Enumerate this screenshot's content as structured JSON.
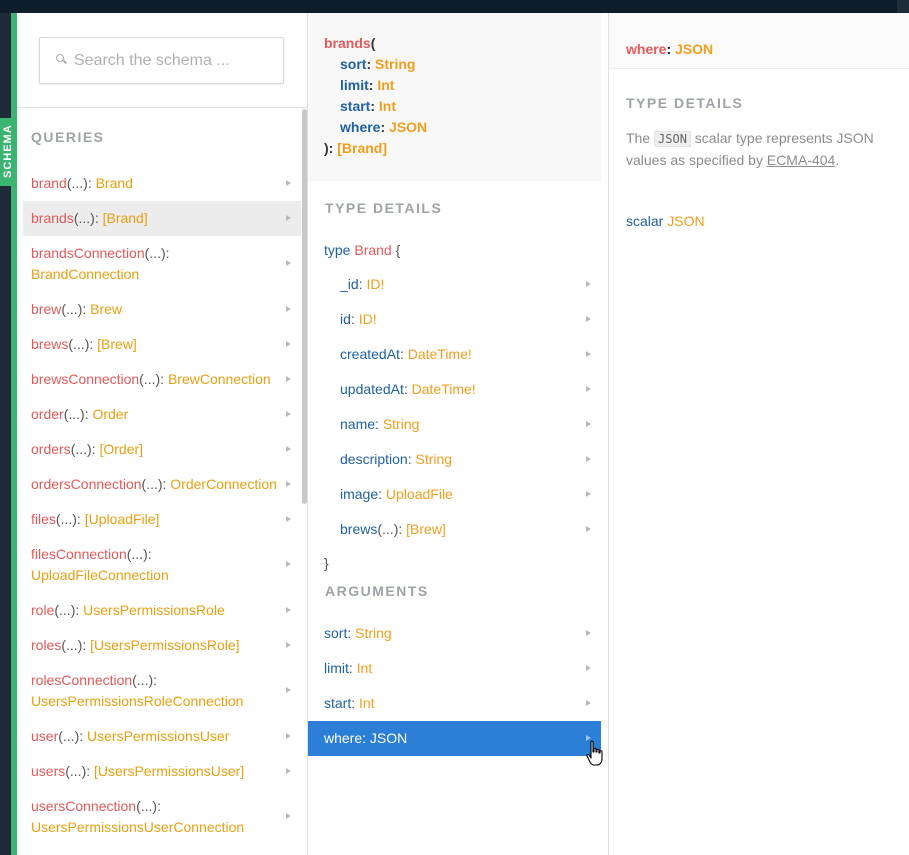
{
  "sidebar_tab": "SCHEMA",
  "search": {
    "placeholder": "Search the schema ..."
  },
  "queries": {
    "title": "QUERIES",
    "items": [
      {
        "name": "brand",
        "args": "(...)",
        "sep": ": ",
        "type": "Brand"
      },
      {
        "name": "brands",
        "args": "(...)",
        "sep": ": ",
        "type": "[Brand]"
      },
      {
        "name": "brandsConnection",
        "args": "(...)",
        "sep": ": ",
        "type": "BrandConnection"
      },
      {
        "name": "brew",
        "args": "(...)",
        "sep": ": ",
        "type": "Brew"
      },
      {
        "name": "brews",
        "args": "(...)",
        "sep": ": ",
        "type": "[Brew]"
      },
      {
        "name": "brewsConnection",
        "args": "(...)",
        "sep": ": ",
        "type": "BrewConnection"
      },
      {
        "name": "order",
        "args": "(...)",
        "sep": ": ",
        "type": "Order"
      },
      {
        "name": "orders",
        "args": "(...)",
        "sep": ": ",
        "type": "[Order]"
      },
      {
        "name": "ordersConnection",
        "args": "(...)",
        "sep": ": ",
        "type": "OrderConnection"
      },
      {
        "name": "files",
        "args": "(...)",
        "sep": ": ",
        "type": "[UploadFile]"
      },
      {
        "name": "filesConnection",
        "args": "(...)",
        "sep": ": ",
        "type": "UploadFileConnection"
      },
      {
        "name": "role",
        "args": "(...)",
        "sep": ": ",
        "type": "UsersPermissionsRole"
      },
      {
        "name": "roles",
        "args": "(...)",
        "sep": ": ",
        "type": "[UsersPermissionsRole]"
      },
      {
        "name": "rolesConnection",
        "args": "(...)",
        "sep": ": ",
        "type": "UsersPermissionsRoleConnection"
      },
      {
        "name": "user",
        "args": "(...)",
        "sep": ": ",
        "type": "UsersPermissionsUser"
      },
      {
        "name": "users",
        "args": "(...)",
        "sep": ": ",
        "type": "[UsersPermissionsUser]"
      },
      {
        "name": "usersConnection",
        "args": "(...)",
        "sep": ": ",
        "type": "UsersPermissionsUserConnection"
      }
    ],
    "active_index": 1
  },
  "brands_panel": {
    "signature": {
      "fn": "brands",
      "open": "(",
      "args": [
        {
          "name": "sort",
          "type": "String"
        },
        {
          "name": "limit",
          "type": "Int"
        },
        {
          "name": "start",
          "type": "Int"
        },
        {
          "name": "where",
          "type": "JSON"
        }
      ],
      "close": "): ",
      "return_type": "[Brand]"
    },
    "type_details_title": "TYPE DETAILS",
    "type_def": {
      "keyword": "type",
      "name": "Brand",
      "open": "{",
      "close": "}",
      "fields": [
        {
          "name": "_id",
          "args": "",
          "type": "ID!"
        },
        {
          "name": "id",
          "args": "",
          "type": "ID!"
        },
        {
          "name": "createdAt",
          "args": "",
          "type": "DateTime!"
        },
        {
          "name": "updatedAt",
          "args": "",
          "type": "DateTime!"
        },
        {
          "name": "name",
          "args": "",
          "type": "String"
        },
        {
          "name": "description",
          "args": "",
          "type": "String"
        },
        {
          "name": "image",
          "args": "",
          "type": "UploadFile"
        },
        {
          "name": "brews",
          "args": "(...)",
          "type": "[Brew]"
        }
      ]
    },
    "arguments_title": "ARGUMENTS",
    "arguments": [
      {
        "name": "sort",
        "type": "String"
      },
      {
        "name": "limit",
        "type": "Int"
      },
      {
        "name": "start",
        "type": "Int"
      },
      {
        "name": "where",
        "type": "JSON"
      }
    ],
    "selected_argument_index": 3
  },
  "json_panel": {
    "header_name": "where",
    "header_sep": ": ",
    "header_type": "JSON",
    "type_details_title": "TYPE DETAILS",
    "desc_before": "The ",
    "desc_code": "JSON",
    "desc_middle": " scalar type represents JSON values as specified by ",
    "desc_link": "ECMA-404",
    "desc_after": ".",
    "scalar_keyword": "scalar",
    "scalar_type": "JSON"
  },
  "colors": {
    "field_name": "#e4595a",
    "type": "#f29e1d",
    "argument": "#1f61a0",
    "selected_bg": "#2b7fd6",
    "active_bg": "#ececec",
    "accent_green": "#3bb371"
  }
}
